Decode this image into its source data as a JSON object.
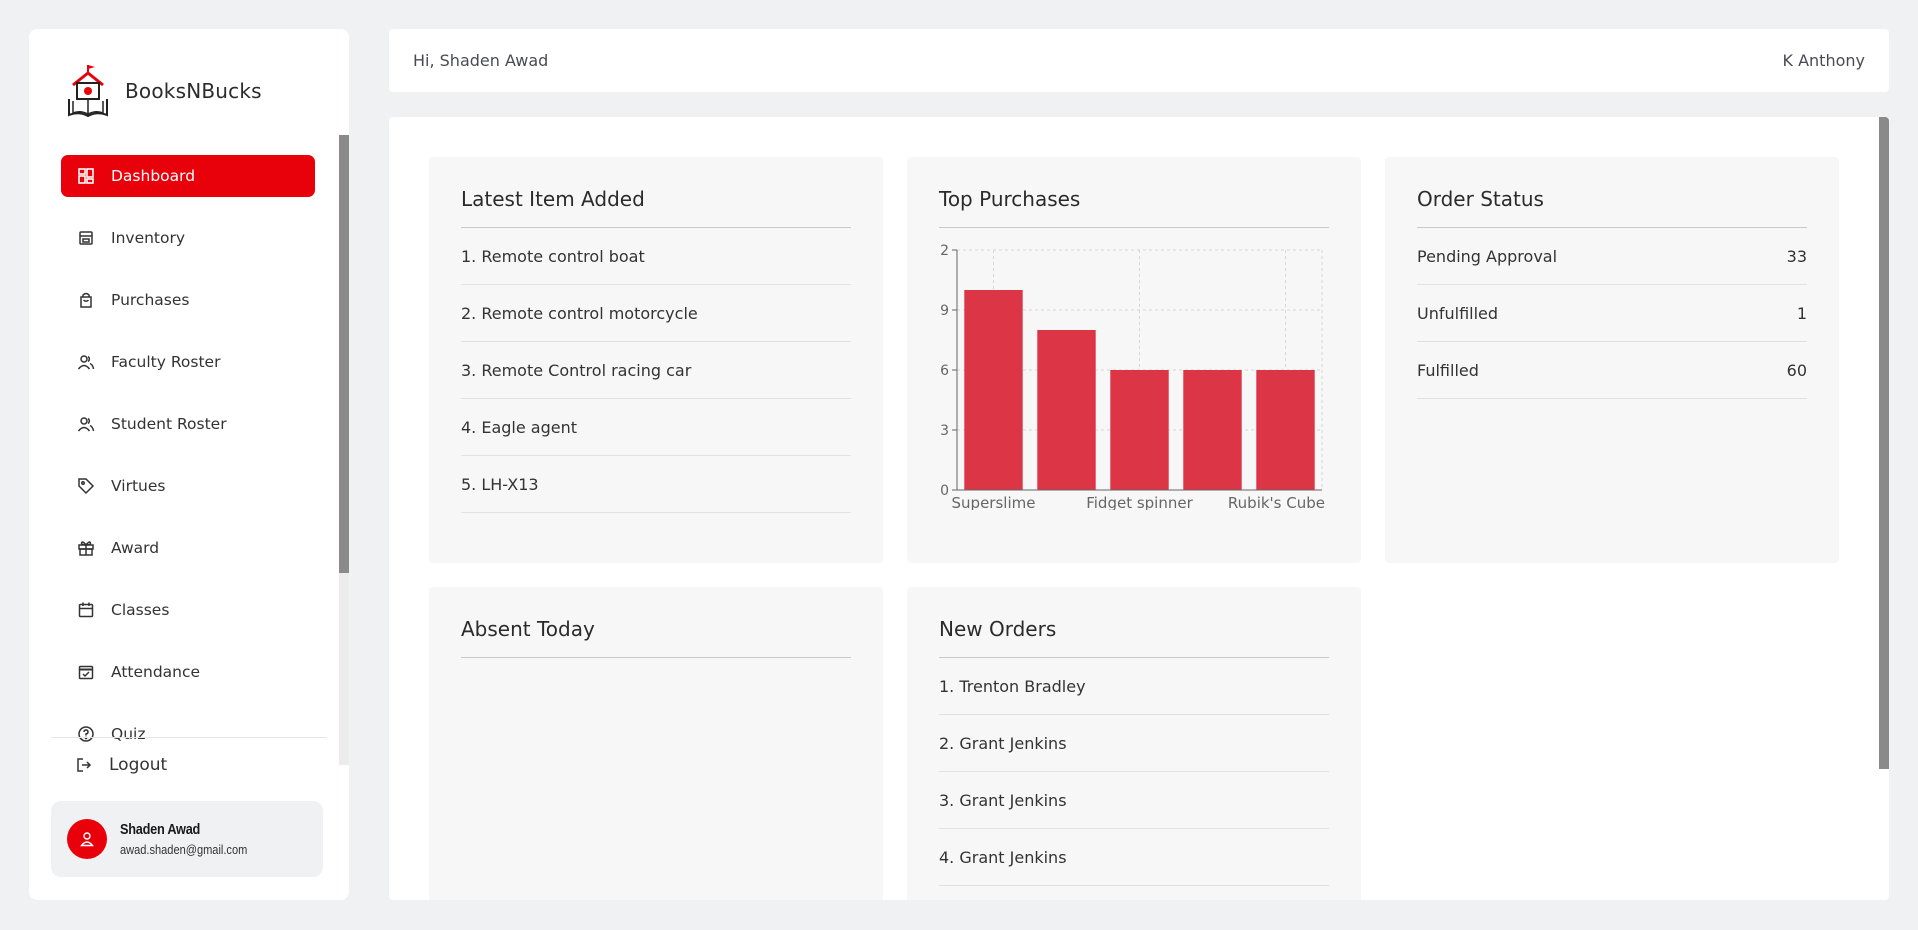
{
  "brand": {
    "name": "BooksNBucks"
  },
  "sidebar": {
    "items": [
      {
        "label": "Dashboard",
        "icon": "dashboard-icon",
        "active": true
      },
      {
        "label": "Inventory",
        "icon": "inventory-icon"
      },
      {
        "label": "Purchases",
        "icon": "shopping-bag-icon"
      },
      {
        "label": "Faculty Roster",
        "icon": "users-icon"
      },
      {
        "label": "Student Roster",
        "icon": "users-icon"
      },
      {
        "label": "Virtues",
        "icon": "tag-icon"
      },
      {
        "label": "Award",
        "icon": "gift-icon"
      },
      {
        "label": "Classes",
        "icon": "calendar-icon"
      },
      {
        "label": "Attendance",
        "icon": "calendar-check-icon"
      },
      {
        "label": "Quiz",
        "icon": "question-icon"
      }
    ],
    "logout_label": "Logout",
    "user": {
      "name": "Shaden Awad",
      "email": "awad.shaden@gmail.com"
    }
  },
  "topbar": {
    "greeting": "Hi, Shaden Awad",
    "right_label": "K Anthony"
  },
  "cards": {
    "latest": {
      "title": "Latest Item Added",
      "items": [
        "1. Remote control boat",
        "2. Remote control motorcycle",
        "3. Remote Control racing car",
        "4. Eagle agent",
        "5. LH-X13"
      ]
    },
    "top_purchases": {
      "title": "Top Purchases"
    },
    "order_status": {
      "title": "Order Status",
      "rows": [
        {
          "label": "Pending Approval",
          "value": "33"
        },
        {
          "label": "Unfulfilled",
          "value": "1"
        },
        {
          "label": "Fulfilled",
          "value": "60"
        }
      ]
    },
    "absent": {
      "title": "Absent Today"
    },
    "new_orders": {
      "title": "New Orders",
      "items": [
        "1. Trenton Bradley",
        "2. Grant Jenkins",
        "3. Grant Jenkins",
        "4. Grant Jenkins"
      ]
    }
  },
  "colors": {
    "accent": "#e8000b",
    "bar": "#dc3545"
  },
  "chart_data": {
    "type": "bar",
    "categories": [
      "Superslime",
      "",
      "Fidget spinner",
      "",
      "Rubik's Cube"
    ],
    "values": [
      10,
      8,
      6,
      6,
      6
    ],
    "ylim": [
      0,
      12
    ],
    "y_tick_labels": [
      "0",
      "3",
      "6",
      "9",
      "2"
    ],
    "x_tick_labels": [
      "Superslime",
      "Fidget spinner",
      "Rubik's Cube"
    ],
    "grid": true,
    "title": "",
    "xlabel": "",
    "ylabel": ""
  }
}
